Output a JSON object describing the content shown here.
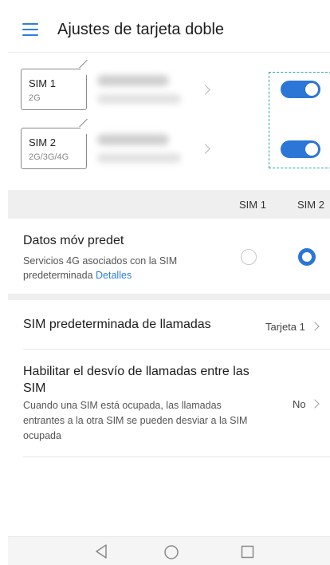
{
  "header": {
    "title": "Ajustes de tarjeta doble",
    "menu_icon": "hamburger-menu-icon",
    "accent": "#2b7fe0"
  },
  "sims": [
    {
      "name": "SIM 1",
      "network": "2G",
      "enabled": true
    },
    {
      "name": "SIM 2",
      "network": "2G/3G/4G",
      "enabled": true
    }
  ],
  "columns": {
    "sim1": "SIM 1",
    "sim2": "SIM 2"
  },
  "datos": {
    "title": "Datos móv predet",
    "subtitle": "Servicios 4G asociados con la SIM predeterminada ",
    "link": "Detalles",
    "selected": "SIM 2"
  },
  "llamadas": {
    "title": "SIM predeterminada de llamadas",
    "value": "Tarjeta 1"
  },
  "desvio": {
    "title": "Habilitar el desvío de llamadas entre las SIM",
    "subtitle": "Cuando una SIM está ocupada, las llamadas entrantes a la otra SIM se pueden desviar a la SIM ocupada",
    "value": "No"
  },
  "colors": {
    "toggle_on": "#2b76d6",
    "highlight_dashes": "#2ea0b0",
    "section_bg": "#efefef"
  },
  "navbar": {
    "icons": [
      "back-icon",
      "home-icon",
      "recent-apps-icon"
    ]
  }
}
